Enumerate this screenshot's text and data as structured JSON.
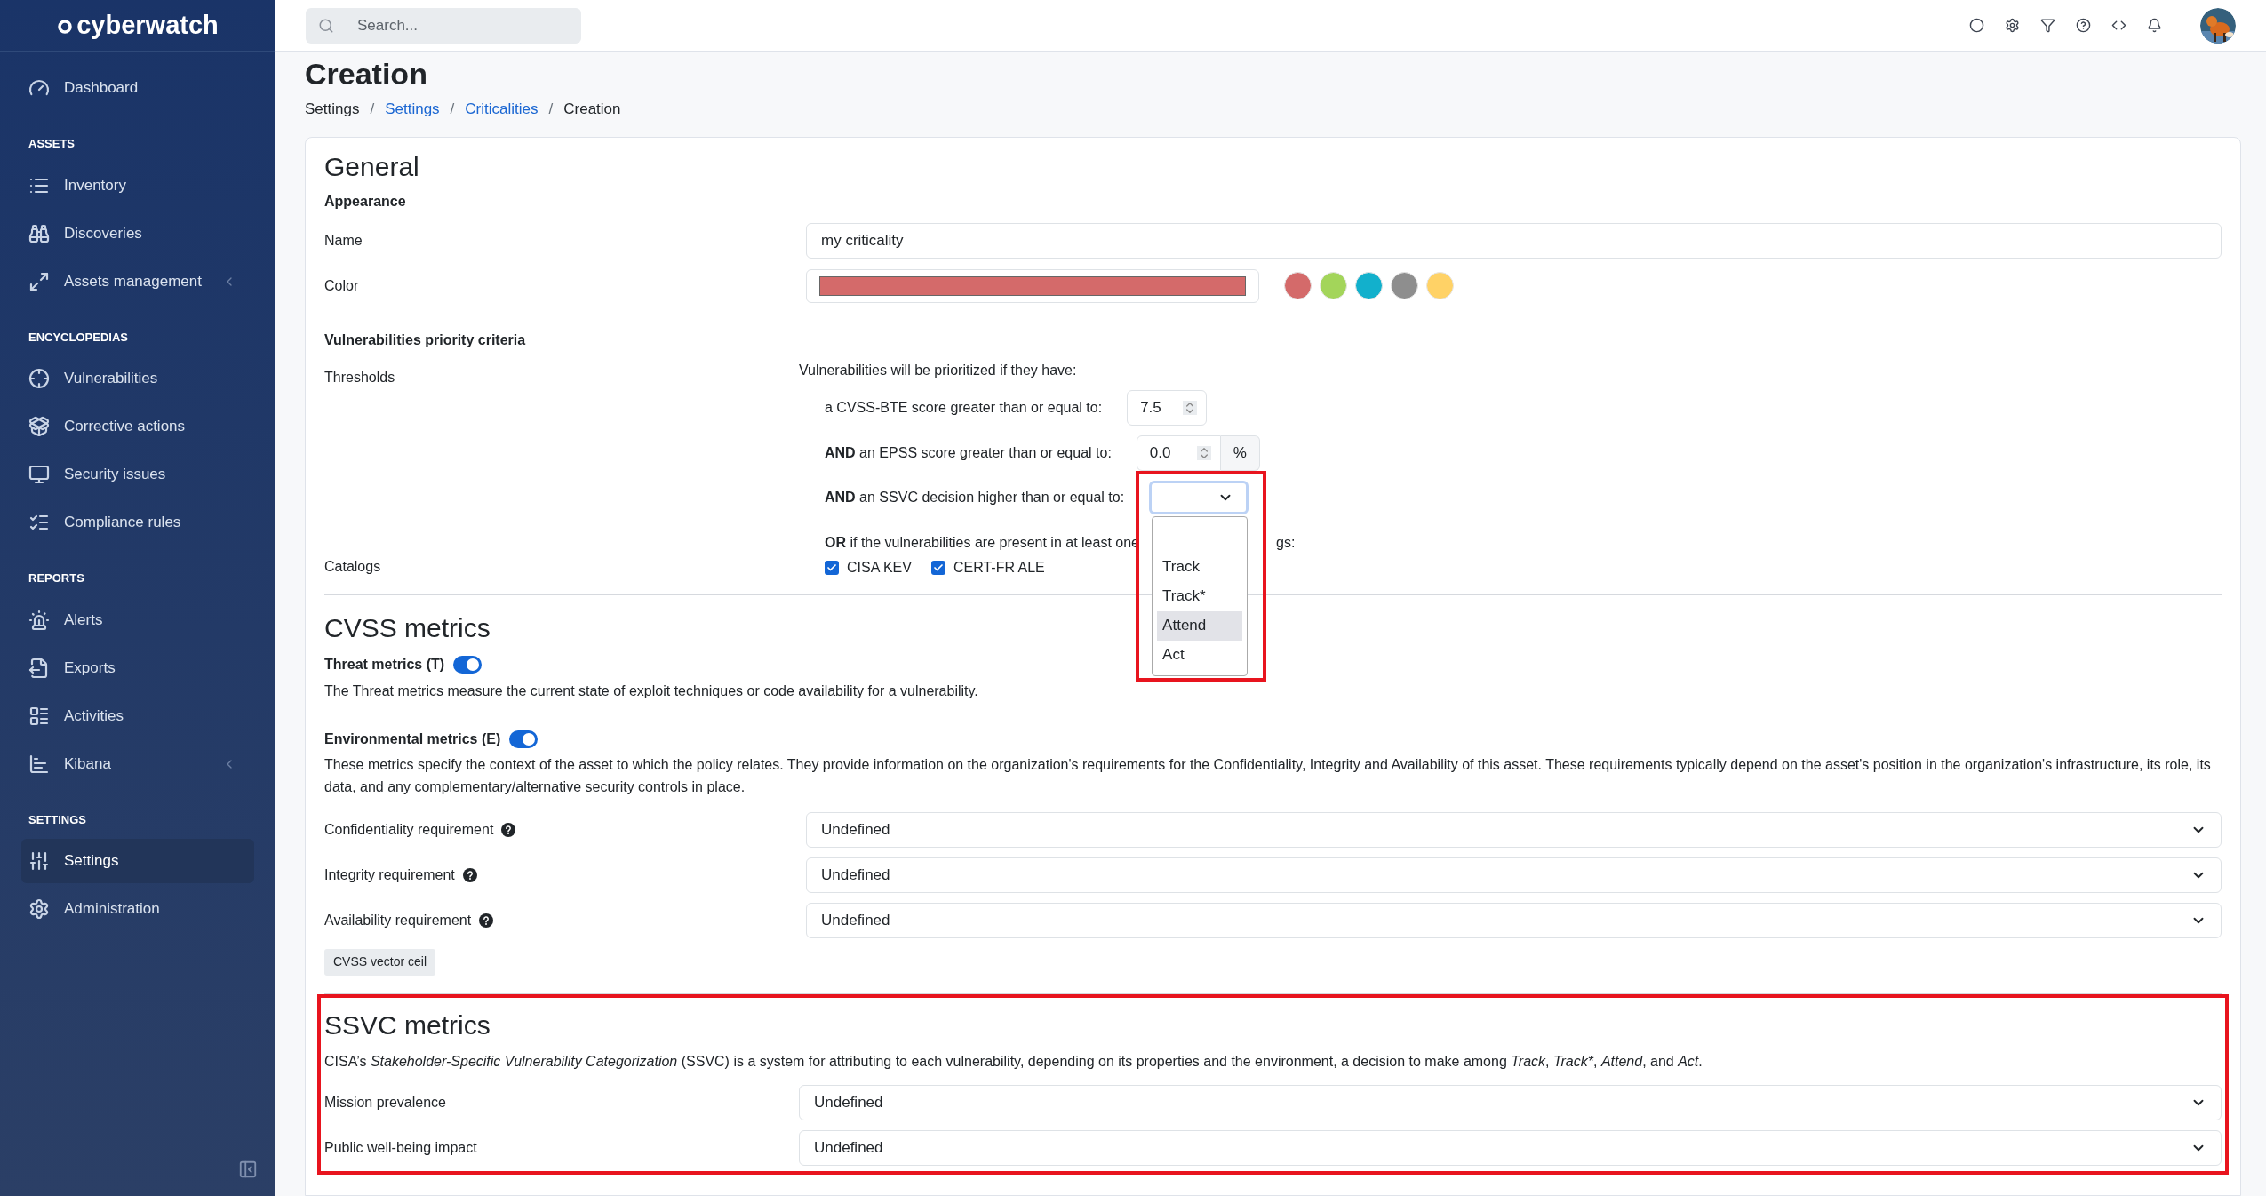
{
  "sidebar": {
    "logo": "cyberwatch",
    "sections": [
      {
        "items": [
          {
            "label": "Dashboard",
            "selected": false,
            "submenu": false
          }
        ]
      },
      {
        "title": "ASSETS",
        "items": [
          {
            "label": "Inventory",
            "selected": false,
            "submenu": false
          },
          {
            "label": "Discoveries",
            "selected": false,
            "submenu": false
          },
          {
            "label": "Assets management",
            "selected": false,
            "submenu": true
          }
        ]
      },
      {
        "title": "ENCYCLOPEDIAS",
        "items": [
          {
            "label": "Vulnerabilities",
            "selected": false,
            "submenu": false
          },
          {
            "label": "Corrective actions",
            "selected": false,
            "submenu": false
          },
          {
            "label": "Security issues",
            "selected": false,
            "submenu": false
          },
          {
            "label": "Compliance rules",
            "selected": false,
            "submenu": false
          }
        ]
      },
      {
        "title": "REPORTS",
        "items": [
          {
            "label": "Alerts",
            "selected": false,
            "submenu": false
          },
          {
            "label": "Exports",
            "selected": false,
            "submenu": false
          },
          {
            "label": "Activities",
            "selected": false,
            "submenu": false
          },
          {
            "label": "Kibana",
            "selected": false,
            "submenu": true
          }
        ]
      },
      {
        "title": "SETTINGS",
        "items": [
          {
            "label": "Settings",
            "selected": true,
            "submenu": false
          },
          {
            "label": "Administration",
            "selected": false,
            "submenu": false
          }
        ]
      }
    ]
  },
  "topbar": {
    "search": {
      "placeholder": "Search..."
    }
  },
  "page": {
    "title": "Creation",
    "breadcrumb": [
      {
        "label": "Settings",
        "kind": "text"
      },
      {
        "label": "/",
        "kind": "separator"
      },
      {
        "label": "Settings",
        "kind": "link"
      },
      {
        "label": "/",
        "kind": "separator"
      },
      {
        "label": "Criticalities",
        "kind": "link"
      },
      {
        "label": "/",
        "kind": "separator"
      },
      {
        "label": "Creation",
        "kind": "text"
      }
    ]
  },
  "general": {
    "title": "General",
    "appearance": "Appearance",
    "name": {
      "label": "Name",
      "value": "my criticality"
    },
    "color": {
      "label": "Color",
      "color": "#d46a6a",
      "swatches": [
        {
          "color": "#d46a6a"
        },
        {
          "color": "#a3d55a"
        },
        {
          "color": "#12b0cc"
        },
        {
          "color": "#8e8e8e"
        },
        {
          "color": "#ffd266"
        }
      ]
    },
    "criteria_title": "Vulnerabilities priority criteria",
    "thresholds_label": "Thresholds",
    "intro": "Vulnerabilities will be prioritized if they have:",
    "cvss": {
      "label": "a CVSS-BTE score greater than or equal to:",
      "value": "7.5"
    },
    "epss": {
      "label": "**AND** an EPSS score greater than or equal to:",
      "value": "0.0",
      "unit": "%"
    },
    "ssvc": {
      "label": "**AND** an SSVC decision higher than or equal to:",
      "open": true,
      "options": [
        {
          "label": "Track",
          "highlighted": false
        },
        {
          "label": "Track*",
          "highlighted": false
        },
        {
          "label": "Attend",
          "highlighted": true
        },
        {
          "label": "Act",
          "highlighted": false
        }
      ]
    },
    "catalogs_label": "Catalogs",
    "catalogs_text": "**OR** if the vulnerabilities are present in at least one",
    "catalogs_text_tail": "gs:",
    "catalogs": [
      {
        "label": "CISA KEV",
        "checked": true
      },
      {
        "label": "CERT-FR ALE",
        "checked": true
      }
    ]
  },
  "cvss_metrics": {
    "title": "CVSS metrics",
    "threat": {
      "label": "Threat metrics (T)",
      "on": true,
      "description": "The Threat metrics measure the current state of exploit techniques or code availability for a vulnerability."
    },
    "environmental": {
      "label": "Environmental metrics (E)",
      "on": true,
      "description": "These metrics specify the context of the asset to which the policy relates. They provide information on the organization's requirements for the Confidentiality, Integrity and Availability of this asset. These requirements typically depend on the asset's position in the organization's infrastructure, its role, its data, and any complementary/alternative security controls in place."
    },
    "requirements": [
      {
        "label": "Confidentiality requirement",
        "help": true,
        "value": "Undefined"
      },
      {
        "label": "Integrity requirement",
        "help": true,
        "value": "Undefined"
      },
      {
        "label": "Availability requirement",
        "help": true,
        "value": "Undefined"
      }
    ],
    "button": "CVSS vector ceil"
  },
  "ssvc_metrics": {
    "title": "SSVC metrics",
    "description_parts": [
      {
        "text": "CISA’s ",
        "italic": false
      },
      {
        "text": "Stakeholder-Specific Vulnerability Categorization",
        "italic": true
      },
      {
        "text": " (SSVC) is a system for attributing to each vulnerability, depending on its properties and the environment, a decision to make among ",
        "italic": false
      },
      {
        "text": "Track",
        "italic": true
      },
      {
        "text": ", ",
        "italic": false
      },
      {
        "text": "Track*",
        "italic": true
      },
      {
        "text": ", ",
        "italic": false
      },
      {
        "text": "Attend",
        "italic": true
      },
      {
        "text": ", and ",
        "italic": false
      },
      {
        "text": "Act",
        "italic": true
      },
      {
        "text": ".",
        "italic": false
      }
    ],
    "fields": [
      {
        "label": "Mission prevalence",
        "value": "Undefined"
      },
      {
        "label": "Public well-being impact",
        "value": "Undefined"
      }
    ]
  }
}
